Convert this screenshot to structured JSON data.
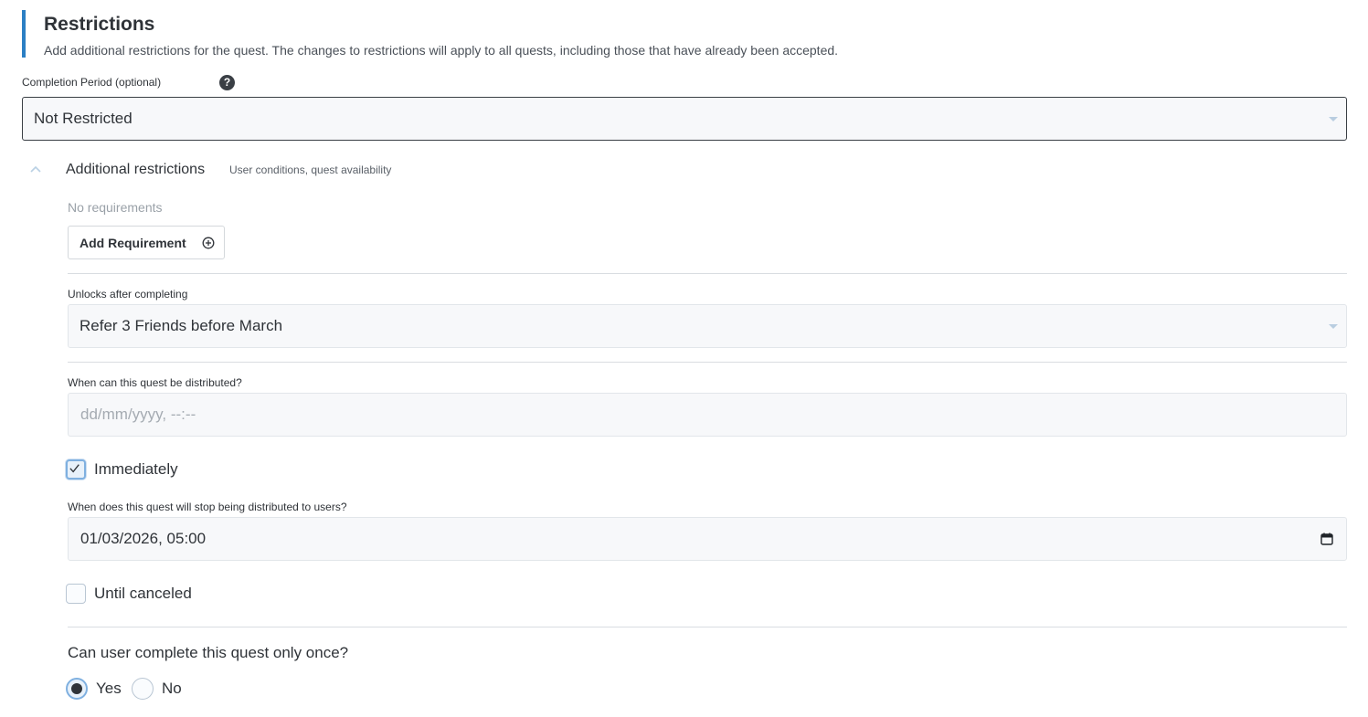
{
  "section": {
    "title": "Restrictions",
    "description": "Add additional restrictions for the quest. The changes to restrictions will apply to all quests, including those that have already been accepted."
  },
  "completion_period": {
    "label": "Completion Period (optional)",
    "help_glyph": "?",
    "value": "Not Restricted"
  },
  "additional": {
    "title": "Additional restrictions",
    "hint": "User conditions, quest availability",
    "expanded": true,
    "no_requirements": "No requirements",
    "add_button_label": "Add Requirement"
  },
  "unlocks": {
    "label": "Unlocks after completing",
    "value": "Refer 3 Friends before March"
  },
  "distribution_start": {
    "label": "When can this quest be distributed?",
    "placeholder": "dd/mm/yyyy, --:--",
    "immediately_label": "Immediately",
    "immediately_checked": true
  },
  "distribution_end": {
    "label": "When does this quest will stop being distributed to users?",
    "value": "01/03/2026, 05:00",
    "until_canceled_label": "Until canceled",
    "until_canceled_checked": false
  },
  "complete_once": {
    "question": "Can user complete this quest only once?",
    "options": [
      {
        "label": "Yes",
        "selected": true
      },
      {
        "label": "No",
        "selected": false
      }
    ]
  },
  "colors": {
    "accent": "#2b7fc4",
    "text": "#2f3338",
    "muted": "#9aa1a8",
    "checkbox_active": "#7fb0e0"
  },
  "icons": {
    "help": "question-circle-icon",
    "chevron": "chevron-up-icon",
    "plus": "plus-circle-icon",
    "calendar": "calendar-icon",
    "check": "check-icon",
    "select_arrow": "caret-down-icon"
  }
}
